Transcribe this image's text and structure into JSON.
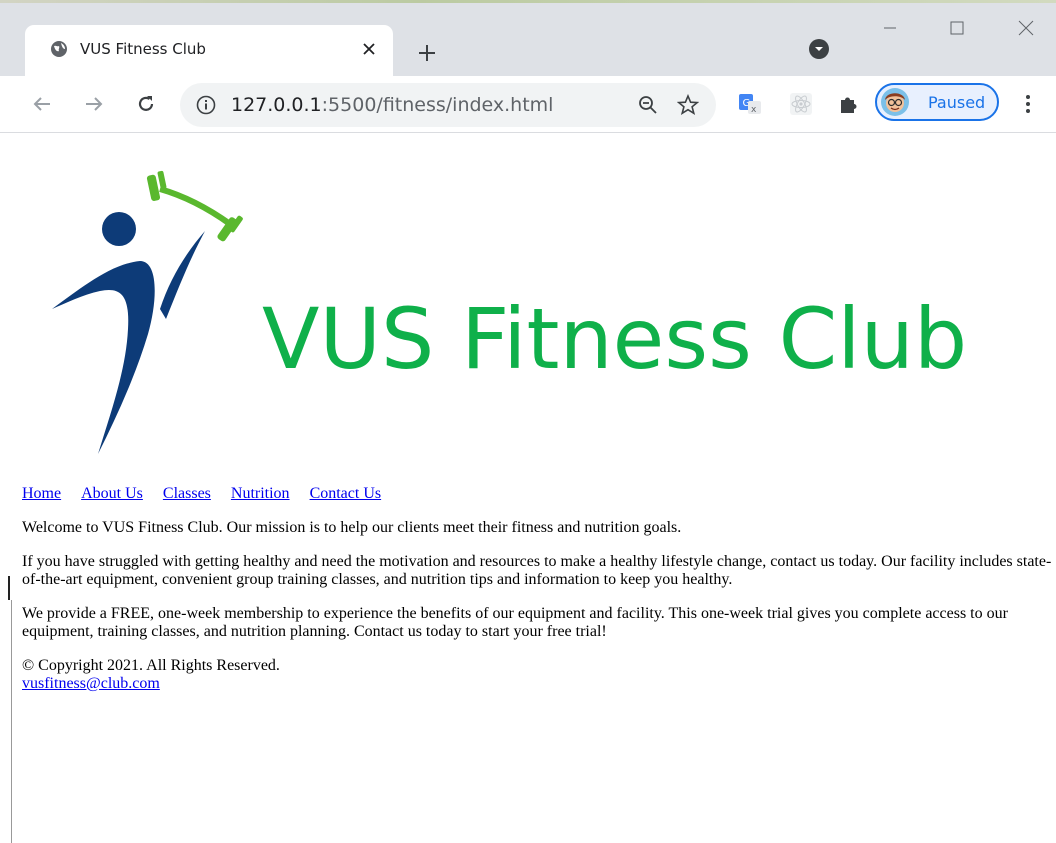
{
  "browser": {
    "tab_title": "VUS Fitness Club",
    "url_host": "127.0.0.1",
    "url_port_path": ":5500/fitness/index.html",
    "profile_label": "Paused",
    "icons": {
      "tab": "globe-icon",
      "close": "close-icon",
      "new_tab": "plus-icon",
      "tab_search": "chevron-down-icon",
      "back": "back-arrow-icon",
      "forward": "forward-arrow-icon",
      "reload": "reload-icon",
      "site_info": "info-icon",
      "zoom": "zoom-out-icon",
      "bookmark": "star-icon",
      "translate": "google-translate-icon",
      "react_devtools": "react-icon",
      "extensions": "puzzle-icon",
      "menu": "kebab-menu-icon"
    }
  },
  "site": {
    "logo_text": "VUS Fitness Club",
    "nav": [
      "Home",
      "About Us",
      "Classes",
      "Nutrition",
      "Contact Us"
    ],
    "paragraphs": [
      "Welcome to VUS Fitness Club. Our mission is to help our clients meet their fitness and nutrition goals.",
      "If you have struggled with getting healthy and need the motivation and resources to make a healthy lifestyle change, contact us today. Our facility includes state-of-the-art equipment, convenient group training classes, and nutrition tips and information to keep you healthy.",
      "We provide a FREE, one-week membership to experience the benefits of our equipment and facility. This one-week trial gives you complete access to our equipment, training classes, and nutrition planning. Contact us today to start your free trial!"
    ],
    "copyright": "© Copyright 2021. All Rights Reserved.",
    "email": "vusfitness@club.com"
  },
  "colors": {
    "logo_green": "#0fb04a",
    "logo_navy": "#0d3b78",
    "link": "#0000ee",
    "profile_blue": "#1a73e8"
  }
}
